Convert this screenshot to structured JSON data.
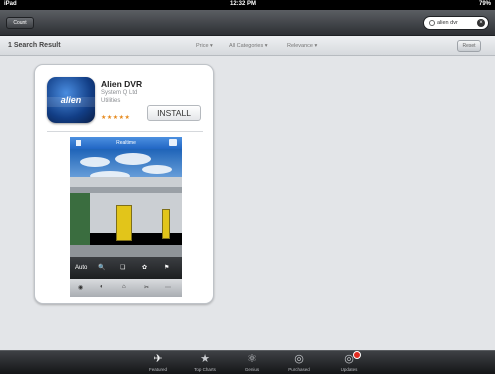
{
  "status_bar": {
    "carrier": "iPad",
    "time": "12:32 PM",
    "battery": "79%"
  },
  "nav": {
    "left_button": "Count",
    "search_value": "alien dvr"
  },
  "filters": {
    "result_count": "1 Search Result",
    "items": [
      {
        "label": "Price ▾"
      },
      {
        "label": "All Categories ▾"
      },
      {
        "label": "Relevance ▾"
      }
    ],
    "reset_label": "Reset"
  },
  "app": {
    "icon_text": "alien",
    "name": "Alien DVR",
    "developer": "System Q Ltd",
    "category": "Utilities",
    "stars": "★★★★★",
    "install_label": "INSTALL",
    "screenshot_title": "Realtime",
    "screenshot_tools_top": [
      "Auto",
      "🔍",
      "❏",
      "✿",
      "⚑"
    ],
    "screenshot_tools_bottom": [
      "◉",
      "◐",
      "⌂",
      "✂",
      "⋯"
    ]
  },
  "tabs": [
    {
      "label": "Featured",
      "icon": "featured-icon",
      "glyph": "✈"
    },
    {
      "label": "Top Charts",
      "icon": "star-icon",
      "glyph": "★"
    },
    {
      "label": "Genius",
      "icon": "genius-icon",
      "glyph": "⚛"
    },
    {
      "label": "Purchased",
      "icon": "purchased-icon",
      "glyph": "◎"
    },
    {
      "label": "Updates",
      "icon": "updates-icon",
      "glyph": "◎"
    }
  ]
}
